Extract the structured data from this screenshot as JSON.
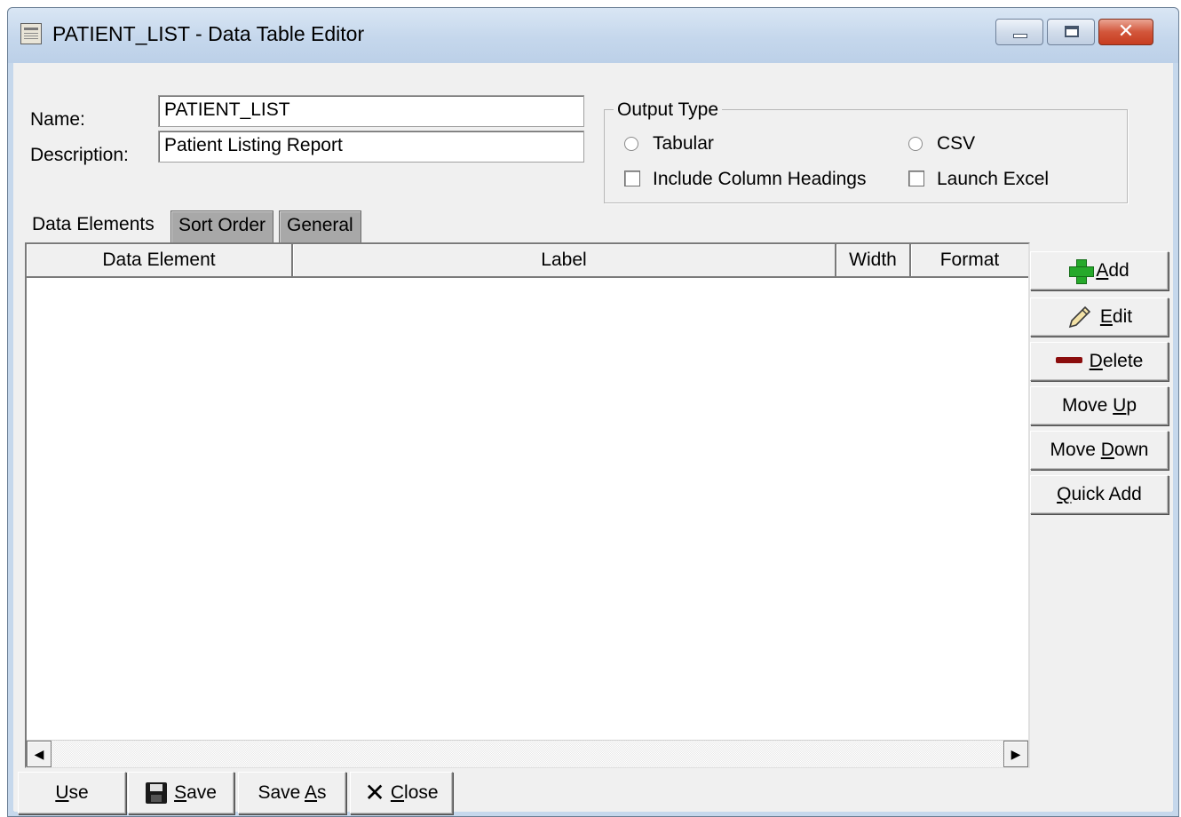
{
  "window": {
    "title": "PATIENT_LIST - Data Table Editor",
    "minimize_icon": "minimize-icon",
    "maximize_icon": "maximize-icon",
    "close_glyph": "✕"
  },
  "form": {
    "name_label": "Name:",
    "name_value": "PATIENT_LIST",
    "description_label": "Description:",
    "description_value": "Patient Listing Report"
  },
  "output_type": {
    "group_label": "Output Type",
    "tabular_label": "Tabular",
    "csv_label": "CSV",
    "include_headings_label": "Include Column Headings",
    "launch_excel_label": "Launch Excel",
    "tabular_selected": false,
    "csv_selected": false,
    "include_headings_checked": false,
    "launch_excel_checked": false
  },
  "tabs": [
    {
      "label": "Data Elements",
      "active": true
    },
    {
      "label": "Sort Order",
      "active": false
    },
    {
      "label": "General",
      "active": false
    }
  ],
  "grid": {
    "columns": [
      "Data Element",
      "Label",
      "Width",
      "Format"
    ],
    "rows": [],
    "scroll_left_glyph": "◀",
    "scroll_right_glyph": "▶"
  },
  "side_buttons": {
    "add": {
      "mnemonic": "A",
      "rest": "dd"
    },
    "edit": {
      "mnemonic": "E",
      "rest": "dit"
    },
    "delete": {
      "mnemonic": "D",
      "rest": "elete"
    },
    "move_up": {
      "before": "Move ",
      "mnemonic": "U",
      "rest": "p"
    },
    "move_down": {
      "before": "Move ",
      "mnemonic": "D",
      "rest": "own"
    },
    "quick_add": {
      "mnemonic": "Q",
      "rest": "uick Add"
    }
  },
  "bottom_buttons": {
    "use": {
      "mnemonic": "U",
      "rest": "se"
    },
    "save": {
      "mnemonic": "S",
      "rest": "ave"
    },
    "save_as": {
      "before": "Save ",
      "mnemonic": "A",
      "rest": "s"
    },
    "close": {
      "mnemonic": "C",
      "rest": "lose",
      "icon_glyph": "✕"
    }
  },
  "colors": {
    "window_bg": "#f0f0f0",
    "inactive_tab": "#a8a8a8",
    "add_icon_green": "#26a92b",
    "delete_icon_red": "#8b0d0d"
  }
}
